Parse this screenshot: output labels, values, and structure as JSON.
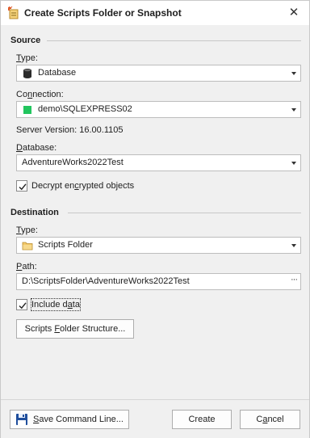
{
  "window": {
    "title": "Create Scripts Folder or Snapshot",
    "close_glyph": "✕"
  },
  "source": {
    "section_title": "Source",
    "type_label_u": "T",
    "type_label_rest": "ype:",
    "type_value": "Database",
    "type_icon": "database-icon",
    "connection_label_pre": "Co",
    "connection_label_u": "n",
    "connection_label_rest": "nection:",
    "connection_value": "demo\\SQLEXPRESS02",
    "connection_status_color": "#22c55e",
    "server_version": "Server Version: 16.00.1105",
    "database_label_u": "D",
    "database_label_rest": "atabase:",
    "database_value": "AdventureWorks2022Test",
    "decrypt_label_pre": "Decrypt en",
    "decrypt_label_u": "c",
    "decrypt_label_rest": "rypted objects",
    "decrypt_checked": true
  },
  "destination": {
    "section_title": "Destination",
    "type_label_u": "T",
    "type_label_rest": "ype:",
    "type_value": "Scripts Folder",
    "type_icon": "folder-icon",
    "path_label_u": "P",
    "path_label_rest": "ath:",
    "path_value": "D:\\ScriptsFolder\\AdventureWorks2022Test",
    "browse_glyph": "···",
    "include_data_label_pre": "Include d",
    "include_data_label_u": "a",
    "include_data_label_rest": "ta",
    "include_data_checked": true,
    "structure_button_pre": "Scripts ",
    "structure_button_u": "F",
    "structure_button_rest": "older Structure..."
  },
  "footer": {
    "save_cmd_pre": "",
    "save_cmd_u": "S",
    "save_cmd_rest": "ave Command Line...",
    "save_icon": "save-icon",
    "save_icon_color": "#1f4e9c",
    "create_label": "Create",
    "cancel_pre": "C",
    "cancel_u": "a",
    "cancel_rest": "ncel"
  },
  "colors": {
    "accent": "#1f4e9c",
    "folder": "#e8b64a"
  }
}
